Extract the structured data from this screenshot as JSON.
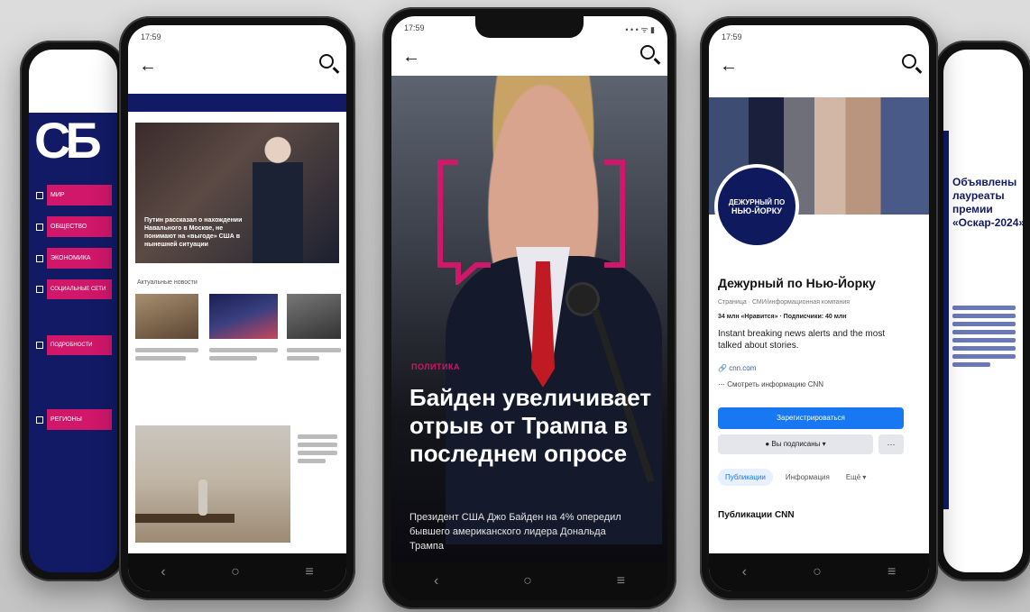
{
  "center": {
    "time": "17:59",
    "status_icons": "• • • ᯤ ▮",
    "category": "ПОЛИТИКА",
    "headline": "Байден увеличивает отрыв от Трампа в последнем опросе",
    "subline": "Президент США Джо Байден на 4% опередил бывшего американского лидера Дональда Трампа",
    "accent": "#d0176a"
  },
  "left_inner": {
    "time": "17:59",
    "hero_caption": "Путин рассказал о нахождении Навального в Москве, не понимают на «выгоде» США в нынешней ситуации",
    "section_title": "Актуальные новости"
  },
  "left_outer": {
    "logo": "СБ",
    "menu": [
      "МИР",
      "ОБЩЕСТВО",
      "ЭКОНОМИКА",
      "СОЦИАЛЬНЫЕ СЕТИ",
      "ПОДРОБНОСТИ",
      "РЕГИОНЫ"
    ]
  },
  "right_inner": {
    "time": "17:59",
    "avatar_line1": "ДЕЖУРНЫЙ ПО",
    "avatar_line2": "НЬЮ-ЙОРКУ",
    "page_name": "Дежурный по Нью-Йорку",
    "page_type": "Страница · СМИ/информационная компания",
    "likes": "34 млн «Нравится» · Подписчики: 40 млн",
    "description": "Instant breaking news alerts and the most talked about stories.",
    "link": "cnn.com",
    "info": "Смотреть информацию CNN",
    "primary_button": "Зарегистрироваться",
    "secondary_button": "Вы подписаны",
    "more_button": "···",
    "tabs": [
      "Публикации",
      "Информация",
      "Ещё"
    ],
    "section_title": "Публикации CNN",
    "brand": "#1877f2"
  },
  "right_outer": {
    "headline": "Объявлены лауреаты премии «Оскар-2024»"
  }
}
